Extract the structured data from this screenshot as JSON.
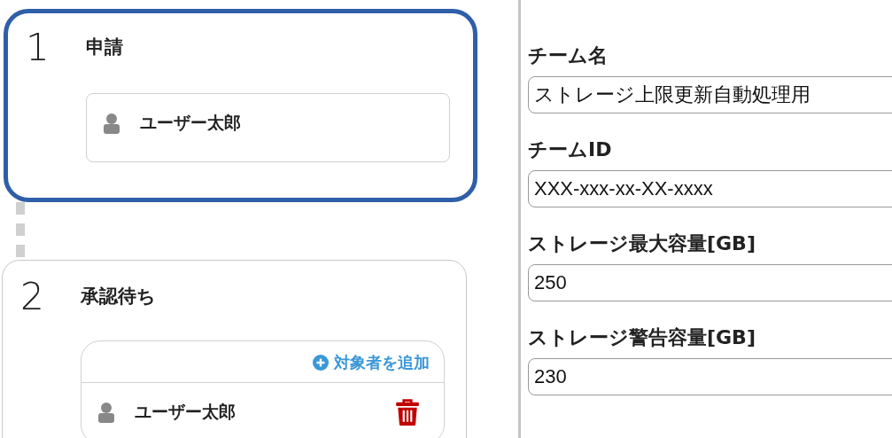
{
  "steps": [
    {
      "number": "1",
      "title": "申請",
      "active": true,
      "assignees": [
        {
          "name": "ユーザー太郎",
          "removable": false
        }
      ]
    },
    {
      "number": "2",
      "title": "承認待ち",
      "active": false,
      "add_action": "対象者を追加",
      "assignees": [
        {
          "name": "ユーザー太郎",
          "removable": true
        }
      ]
    }
  ],
  "form": {
    "fields": [
      {
        "label": "チーム名",
        "value": "ストレージ上限更新自動処理用"
      },
      {
        "label": "チームID",
        "value": "XXX-xxx-xx-XX-xxxx"
      },
      {
        "label": "ストレージ最大容量[GB]",
        "value": "250"
      },
      {
        "label": "ストレージ警告容量[GB]",
        "value": "230"
      }
    ]
  }
}
